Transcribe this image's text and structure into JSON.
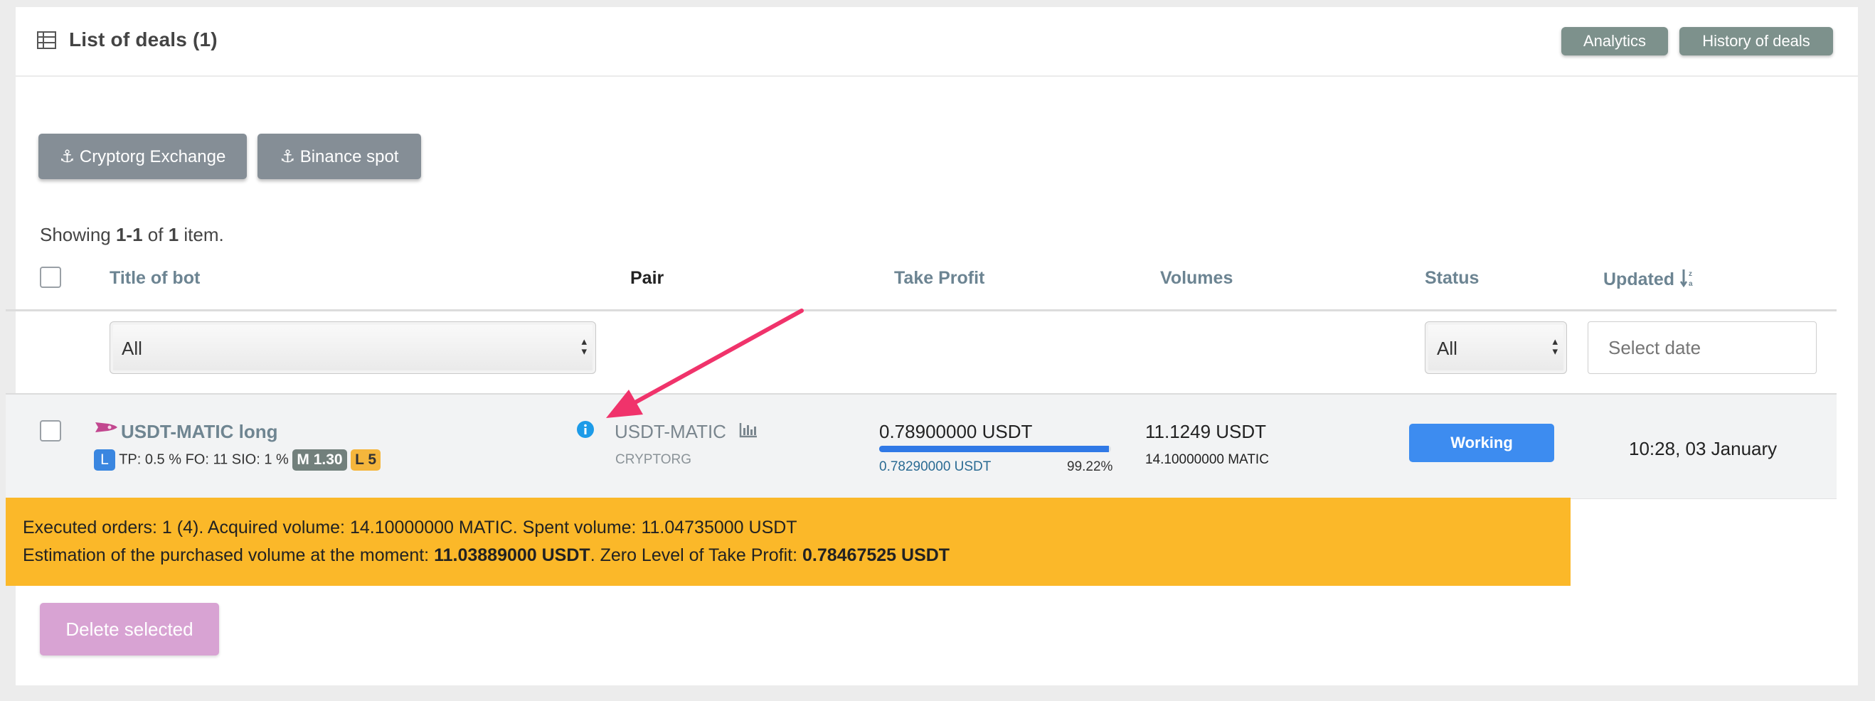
{
  "header": {
    "title": "List of deals (1)",
    "icon": "table-icon",
    "analytics_label": "Analytics",
    "history_label": "History of deals"
  },
  "exchanges": [
    {
      "label": "Cryptorg Exchange",
      "icon": "anchor-icon"
    },
    {
      "label": "Binance spot",
      "icon": "anchor-icon"
    }
  ],
  "summary": {
    "prefix": "Showing ",
    "range": "1-1",
    "of": " of ",
    "total": "1",
    "suffix": " item."
  },
  "table": {
    "columns": {
      "title": "Title of bot",
      "pair": "Pair",
      "take_profit": "Take Profit",
      "volumes": "Volumes",
      "status": "Status",
      "updated": "Updated"
    },
    "filters": {
      "title_select": "All",
      "status_select": "All",
      "date_placeholder": "Select date"
    }
  },
  "row": {
    "bot_title": "USDT-MATIC long",
    "badge_l": "L",
    "params": "TP: 0.5 % FO: 11 SIO: 1 %",
    "badge_m": "M 1.30",
    "badge_l5": "L 5",
    "pair": "USDT-MATIC",
    "exchange": "CRYPTORG",
    "tp_value": "0.78900000 USDT",
    "tp_current": "0.78290000 USDT",
    "tp_percent": "99.22%",
    "tp_progress": 0.9922,
    "volume_quote": "11.1249 USDT",
    "volume_base": "14.10000000 MATIC",
    "status": "Working",
    "updated": "10:28, 03 January"
  },
  "notice": {
    "line1": "Executed orders: 1 (4). Acquired volume: 14.10000000 MATIC. Spent volume: 11.04735000 USDT",
    "line2_prefix": "Estimation of the purchased volume at the moment: ",
    "line2_estimate": "11.03889000 USDT",
    "line2_mid": ". Zero Level of Take Profit: ",
    "line2_zero": "0.78467525 USDT"
  },
  "actions": {
    "delete_label": "Delete selected"
  },
  "colors": {
    "accent_blue": "#3d8cf0",
    "notice_yellow": "#fbb829",
    "annotation_arrow": "#f0336b"
  }
}
